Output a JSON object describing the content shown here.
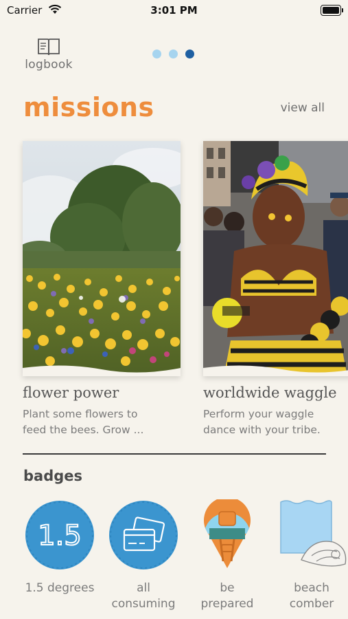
{
  "status_bar": {
    "carrier": "Carrier",
    "time": "3:01 PM"
  },
  "header": {
    "logbook_label": "logbook",
    "page_dots": {
      "count": 3,
      "active_index": 2
    }
  },
  "missions": {
    "title": "missions",
    "view_all": "view all",
    "cards": [
      {
        "title": "flower power",
        "desc_line1": "Plant some flowers to",
        "desc_line2": "feed the bees. Grow ...",
        "image": "wildflower-meadow-photo"
      },
      {
        "title": "worldwide waggle",
        "desc_line1": "Perform your waggle",
        "desc_line2": "dance with your tribe.",
        "image": "carnival-bee-costume-photo"
      }
    ]
  },
  "badges": {
    "title": "badges",
    "items": [
      {
        "label_line1": "1.5 degrees",
        "label_line2": "",
        "icon_text": "1.5",
        "icon": "1-5-degrees-badge-icon"
      },
      {
        "label_line1": "all",
        "label_line2": "consuming",
        "icon": "credit-cards-badge-icon"
      },
      {
        "label_line1": "be",
        "label_line2": "prepared",
        "icon": "backpack-badge-icon"
      },
      {
        "label_line1": "beach",
        "label_line2": "comber",
        "icon": "shell-badge-icon"
      }
    ]
  },
  "colors": {
    "background": "#f6f3ec",
    "accent_orange": "#ee8d3d",
    "badge_blue": "#3b95cf",
    "dot_active": "#1e5fa2",
    "dot_inactive": "#a6d4ef"
  }
}
